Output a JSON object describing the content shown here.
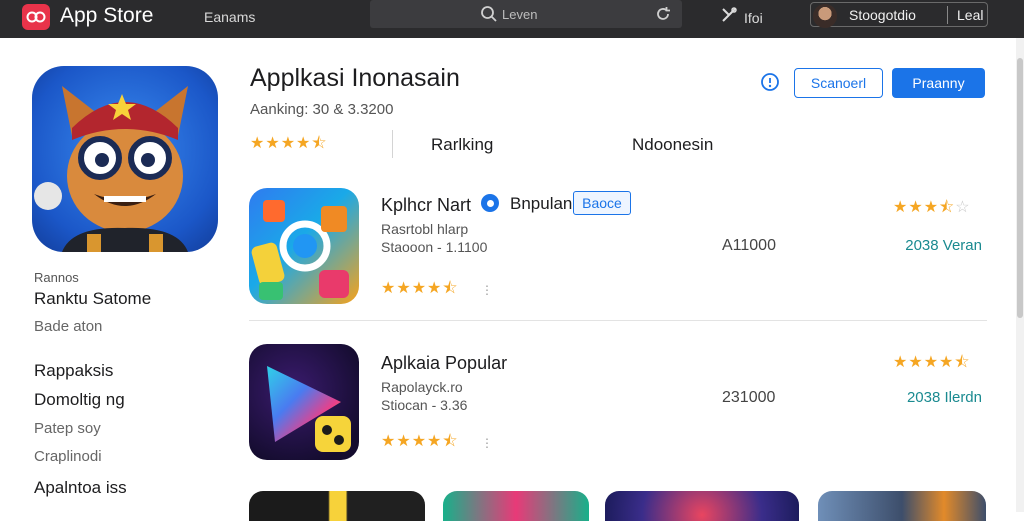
{
  "topbar": {
    "app_name": "App Store",
    "nav": "Eanams",
    "search_placeholder": "Leven",
    "tools_label": "Ifoi",
    "user_name": "Stoogotdio",
    "user_action": "Leal"
  },
  "sidebar": {
    "section_label": "Rannos",
    "items": [
      {
        "label": "Ranktu Satome"
      },
      {
        "label": "Bade aton"
      },
      {
        "label": "Rappaksis"
      },
      {
        "label": "Domoltig ng"
      },
      {
        "label": "Patep soy"
      },
      {
        "label": "Craplinodi"
      },
      {
        "label": "Apalntoa iss"
      }
    ]
  },
  "header": {
    "title": "Applkasi Inonasain",
    "subtitle": "Aanking: 30 & 3.3200",
    "rating": 4.5,
    "tabs": [
      "Rarlking",
      "Ndoonesin"
    ],
    "outline_button": "Scanoerl",
    "primary_button": "Praanny"
  },
  "apps": [
    {
      "name": "Kplhcr Nart",
      "category": "Bnpulan",
      "badge": "Baoce",
      "meta1": "Rasrtobl hlarp",
      "meta2": "Staooon - 1.1100",
      "count": "A11000",
      "version": "2038 Veran",
      "rating": 3.5,
      "list_rating": 4.5
    },
    {
      "name": "Aplkaia Popular",
      "meta1": "Rapolayck.ro",
      "meta2": "Stiocan - 3.36",
      "count": "231000",
      "version": "2038 Ilerdn",
      "rating": 4.5,
      "list_rating": 4.5
    }
  ],
  "colors": {
    "accent": "#1b74e8",
    "star": "#f5a623",
    "version": "#1a8a90",
    "topbar": "#2b2b2d"
  }
}
